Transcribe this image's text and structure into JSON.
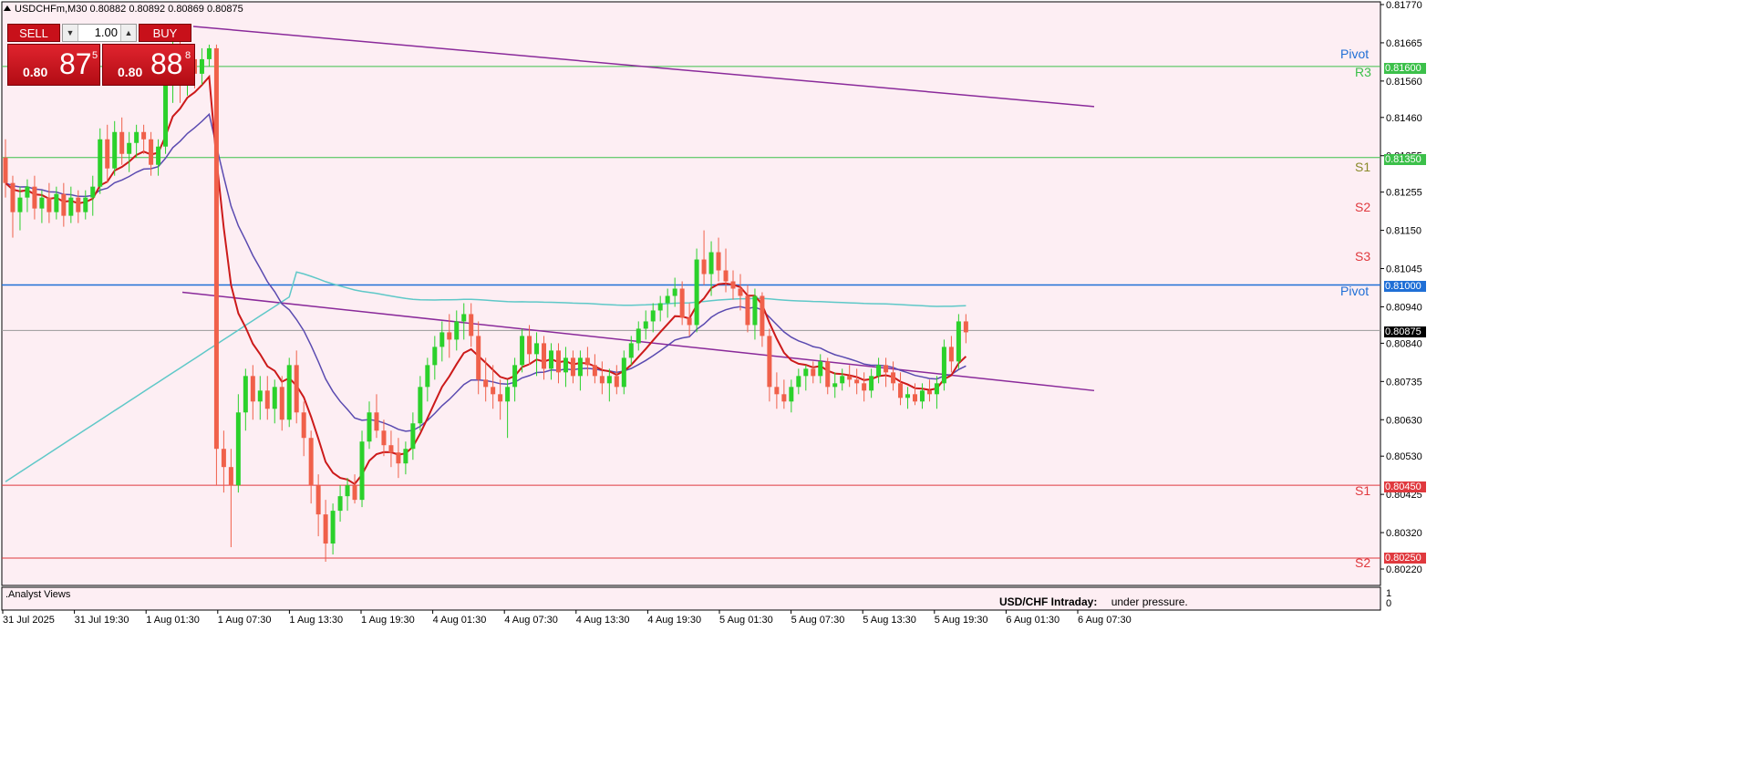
{
  "window": {
    "title": "USDCHFm,M30  0.80882 0.80892 0.80869 0.80875"
  },
  "trade_panel": {
    "sell_label": "SELL",
    "buy_label": "BUY",
    "lot_value": "1.00",
    "sell_price": {
      "prefix": "0.80",
      "big": "87",
      "sup": "5"
    },
    "buy_price": {
      "prefix": "0.80",
      "big": "88",
      "sup": "8"
    }
  },
  "price_axis": [
    "0.81770",
    "0.81665",
    "0.81560",
    "0.81460",
    "0.81355",
    "0.81255",
    "0.81150",
    "0.81045",
    "0.80940",
    "0.80840",
    "0.80735",
    "0.80630",
    "0.80530",
    "0.80425",
    "0.80320",
    "0.80220"
  ],
  "time_axis": [
    "31 Jul 2025",
    "31 Jul 19:30",
    "1 Aug 01:30",
    "1 Aug 07:30",
    "1 Aug 13:30",
    "1 Aug 19:30",
    "4 Aug 01:30",
    "4 Aug 07:30",
    "4 Aug 13:30",
    "4 Aug 19:30",
    "5 Aug 01:30",
    "5 Aug 07:30",
    "5 Aug 13:30",
    "5 Aug 19:30",
    "6 Aug 01:30",
    "6 Aug 07:30"
  ],
  "price_tags": {
    "r3": "0.81600",
    "s1_top": "0.81350",
    "pivot": "0.81000",
    "current": "0.80875",
    "s1": "0.80450",
    "s2": "0.80250"
  },
  "level_labels": {
    "pivot_top": "Pivot",
    "r3": "R3",
    "s1_upper": "S1",
    "s2_upper": "S2",
    "s3_upper": "S3",
    "pivot": "Pivot",
    "s1": "S1",
    "s2": "S2"
  },
  "subwindow": {
    "title": ".Analyst Views",
    "axis_top": "1",
    "axis_bottom": "0",
    "heading": "USD/CHF Intraday:",
    "status": "under pressure."
  },
  "colors": {
    "background": "#fdeef3",
    "bull": "#2bd12b",
    "bear": "#f0604a",
    "pivot_line": "#1f6fd6",
    "resistance_line": "#3cc04a",
    "support_line": "#e0393e",
    "trend_line": "#8a2a9a",
    "ma_fast": "#cc1a1a",
    "ma_mid": "#5a4ab0",
    "ma_slow": "#5fc8c8"
  },
  "chart_data": {
    "type": "candlestick",
    "symbol": "USDCHFm",
    "timeframe": "M30",
    "ylim": [
      0.8217,
      0.8182
    ],
    "levels": [
      {
        "label": "R3",
        "value": 0.816
      },
      {
        "label": "Pivot",
        "value": 0.81
      },
      {
        "label": "S1",
        "value": 0.8045
      },
      {
        "label": "S2",
        "value": 0.8025
      }
    ],
    "last_price": 0.80875,
    "ohlc": [
      [
        0.8135,
        0.814,
        0.8124,
        0.8128
      ],
      [
        0.8128,
        0.813,
        0.8113,
        0.812
      ],
      [
        0.812,
        0.8127,
        0.8115,
        0.8124
      ],
      [
        0.8124,
        0.8129,
        0.812,
        0.8127
      ],
      [
        0.8127,
        0.813,
        0.8118,
        0.8121
      ],
      [
        0.8121,
        0.8126,
        0.8117,
        0.8124
      ],
      [
        0.8124,
        0.8128,
        0.8117,
        0.812
      ],
      [
        0.812,
        0.8127,
        0.8118,
        0.8125
      ],
      [
        0.8125,
        0.8128,
        0.8116,
        0.8119
      ],
      [
        0.8119,
        0.8127,
        0.8117,
        0.8124
      ],
      [
        0.8124,
        0.8126,
        0.8117,
        0.812
      ],
      [
        0.812,
        0.8126,
        0.8118,
        0.8124
      ],
      [
        0.8124,
        0.813,
        0.8119,
        0.8127
      ],
      [
        0.8127,
        0.8143,
        0.8125,
        0.814
      ],
      [
        0.814,
        0.8144,
        0.8128,
        0.8132
      ],
      [
        0.8132,
        0.8145,
        0.813,
        0.8142
      ],
      [
        0.8142,
        0.8146,
        0.8133,
        0.8136
      ],
      [
        0.8136,
        0.8142,
        0.8131,
        0.8139
      ],
      [
        0.8139,
        0.8144,
        0.8135,
        0.8142
      ],
      [
        0.8142,
        0.8144,
        0.8136,
        0.814
      ],
      [
        0.814,
        0.8142,
        0.813,
        0.8133
      ],
      [
        0.8133,
        0.814,
        0.813,
        0.8138
      ],
      [
        0.8138,
        0.816,
        0.8136,
        0.8157
      ],
      [
        0.8157,
        0.8168,
        0.815,
        0.8165
      ],
      [
        0.8165,
        0.8168,
        0.815,
        0.8156
      ],
      [
        0.8156,
        0.8166,
        0.8152,
        0.8162
      ],
      [
        0.8162,
        0.8164,
        0.8154,
        0.8158
      ],
      [
        0.8158,
        0.8165,
        0.8155,
        0.8162
      ],
      [
        0.8162,
        0.8166,
        0.816,
        0.8165
      ],
      [
        0.8165,
        0.8166,
        0.8045,
        0.8055
      ],
      [
        0.8055,
        0.806,
        0.8043,
        0.805
      ],
      [
        0.805,
        0.8055,
        0.8028,
        0.8045
      ],
      [
        0.8045,
        0.807,
        0.8043,
        0.8065
      ],
      [
        0.8065,
        0.8077,
        0.806,
        0.8075
      ],
      [
        0.8075,
        0.8078,
        0.8063,
        0.8068
      ],
      [
        0.8068,
        0.8075,
        0.8063,
        0.8071
      ],
      [
        0.8071,
        0.8075,
        0.8063,
        0.8066
      ],
      [
        0.8066,
        0.8074,
        0.8062,
        0.8072
      ],
      [
        0.8072,
        0.8075,
        0.806,
        0.8063
      ],
      [
        0.8063,
        0.808,
        0.8061,
        0.8078
      ],
      [
        0.8078,
        0.8082,
        0.8062,
        0.8065
      ],
      [
        0.8065,
        0.8068,
        0.8053,
        0.8058
      ],
      [
        0.8058,
        0.806,
        0.804,
        0.8045
      ],
      [
        0.8045,
        0.8048,
        0.8031,
        0.8037
      ],
      [
        0.8037,
        0.8041,
        0.8024,
        0.8029
      ],
      [
        0.8029,
        0.804,
        0.8026,
        0.8038
      ],
      [
        0.8038,
        0.8045,
        0.8035,
        0.8042
      ],
      [
        0.8042,
        0.8047,
        0.8038,
        0.8045
      ],
      [
        0.8045,
        0.8048,
        0.804,
        0.8041
      ],
      [
        0.8041,
        0.806,
        0.8039,
        0.8057
      ],
      [
        0.8057,
        0.8068,
        0.8055,
        0.8065
      ],
      [
        0.8065,
        0.807,
        0.8058,
        0.806
      ],
      [
        0.806,
        0.8063,
        0.8053,
        0.8056
      ],
      [
        0.8056,
        0.806,
        0.805,
        0.8054
      ],
      [
        0.8054,
        0.8058,
        0.8047,
        0.8051
      ],
      [
        0.8051,
        0.8057,
        0.8048,
        0.8055
      ],
      [
        0.8055,
        0.8065,
        0.8052,
        0.8062
      ],
      [
        0.8062,
        0.8075,
        0.806,
        0.8072
      ],
      [
        0.8072,
        0.808,
        0.8068,
        0.8078
      ],
      [
        0.8078,
        0.8086,
        0.8074,
        0.8083
      ],
      [
        0.8083,
        0.809,
        0.8079,
        0.8087
      ],
      [
        0.8087,
        0.8092,
        0.808,
        0.8085
      ],
      [
        0.8085,
        0.8093,
        0.8082,
        0.809
      ],
      [
        0.809,
        0.8095,
        0.8085,
        0.8092
      ],
      [
        0.8092,
        0.8095,
        0.8083,
        0.8086
      ],
      [
        0.8086,
        0.809,
        0.807,
        0.8074
      ],
      [
        0.8074,
        0.808,
        0.8068,
        0.8072
      ],
      [
        0.8072,
        0.8078,
        0.8066,
        0.807
      ],
      [
        0.807,
        0.8074,
        0.8063,
        0.8068
      ],
      [
        0.8068,
        0.8074,
        0.8058,
        0.8072
      ],
      [
        0.8072,
        0.808,
        0.8068,
        0.8078
      ],
      [
        0.8078,
        0.8088,
        0.8076,
        0.8086
      ],
      [
        0.8086,
        0.8089,
        0.8078,
        0.8081
      ],
      [
        0.8081,
        0.8087,
        0.8075,
        0.8084
      ],
      [
        0.8084,
        0.8086,
        0.8074,
        0.8077
      ],
      [
        0.8077,
        0.8084,
        0.8074,
        0.8082
      ],
      [
        0.8082,
        0.8084,
        0.8073,
        0.8076
      ],
      [
        0.8076,
        0.8083,
        0.8072,
        0.808
      ],
      [
        0.808,
        0.8082,
        0.8073,
        0.8075
      ],
      [
        0.8075,
        0.8082,
        0.8071,
        0.808
      ],
      [
        0.808,
        0.8083,
        0.8075,
        0.8078
      ],
      [
        0.8078,
        0.8081,
        0.8073,
        0.8075
      ],
      [
        0.8075,
        0.8079,
        0.807,
        0.8073
      ],
      [
        0.8073,
        0.8077,
        0.8068,
        0.8075
      ],
      [
        0.8075,
        0.8078,
        0.807,
        0.8072
      ],
      [
        0.8072,
        0.8082,
        0.807,
        0.808
      ],
      [
        0.808,
        0.8086,
        0.8078,
        0.8084
      ],
      [
        0.8084,
        0.809,
        0.8082,
        0.8088
      ],
      [
        0.8088,
        0.8093,
        0.8085,
        0.809
      ],
      [
        0.809,
        0.8095,
        0.8087,
        0.8093
      ],
      [
        0.8093,
        0.8097,
        0.809,
        0.8095
      ],
      [
        0.8095,
        0.8099,
        0.8091,
        0.8097
      ],
      [
        0.8097,
        0.8102,
        0.8094,
        0.8099
      ],
      [
        0.8099,
        0.8101,
        0.8089,
        0.8091
      ],
      [
        0.8091,
        0.8095,
        0.8086,
        0.8089
      ],
      [
        0.8089,
        0.811,
        0.8087,
        0.8107
      ],
      [
        0.8107,
        0.8115,
        0.81,
        0.8103
      ],
      [
        0.8103,
        0.8112,
        0.8097,
        0.8109
      ],
      [
        0.8109,
        0.8113,
        0.8101,
        0.8104
      ],
      [
        0.8104,
        0.811,
        0.8098,
        0.8101
      ],
      [
        0.8101,
        0.8104,
        0.8096,
        0.8099
      ],
      [
        0.8099,
        0.8103,
        0.8093,
        0.8097
      ],
      [
        0.8097,
        0.81,
        0.8087,
        0.8089
      ],
      [
        0.8089,
        0.8099,
        0.8085,
        0.8097
      ],
      [
        0.8097,
        0.8098,
        0.8083,
        0.8086
      ],
      [
        0.8086,
        0.8088,
        0.8068,
        0.8072
      ],
      [
        0.8072,
        0.8076,
        0.8066,
        0.807
      ],
      [
        0.807,
        0.8074,
        0.8066,
        0.8068
      ],
      [
        0.8068,
        0.8074,
        0.8065,
        0.8072
      ],
      [
        0.8072,
        0.8077,
        0.807,
        0.8075
      ],
      [
        0.8075,
        0.8078,
        0.8071,
        0.8077
      ],
      [
        0.8077,
        0.8079,
        0.8073,
        0.8075
      ],
      [
        0.8075,
        0.8081,
        0.8073,
        0.8079
      ],
      [
        0.8079,
        0.808,
        0.807,
        0.8072
      ],
      [
        0.8072,
        0.8076,
        0.8069,
        0.8073
      ],
      [
        0.8073,
        0.8077,
        0.8071,
        0.8075
      ],
      [
        0.8075,
        0.8078,
        0.8072,
        0.8074
      ],
      [
        0.8074,
        0.8077,
        0.807,
        0.8073
      ],
      [
        0.8073,
        0.8076,
        0.8068,
        0.8071
      ],
      [
        0.8071,
        0.8077,
        0.8069,
        0.8075
      ],
      [
        0.8075,
        0.808,
        0.8073,
        0.8078
      ],
      [
        0.8078,
        0.808,
        0.8072,
        0.8076
      ],
      [
        0.8076,
        0.8079,
        0.8071,
        0.8073
      ],
      [
        0.8073,
        0.8076,
        0.8067,
        0.8069
      ],
      [
        0.8069,
        0.8072,
        0.8066,
        0.807
      ],
      [
        0.807,
        0.8073,
        0.8067,
        0.8068
      ],
      [
        0.8068,
        0.8073,
        0.8066,
        0.8071
      ],
      [
        0.8071,
        0.8074,
        0.8068,
        0.807
      ],
      [
        0.807,
        0.8075,
        0.8066,
        0.8073
      ],
      [
        0.8073,
        0.8085,
        0.8071,
        0.8083
      ],
      [
        0.8083,
        0.8086,
        0.8076,
        0.8079
      ],
      [
        0.8079,
        0.8092,
        0.8077,
        0.809
      ],
      [
        0.809,
        0.8092,
        0.8084,
        0.8087
      ]
    ]
  }
}
